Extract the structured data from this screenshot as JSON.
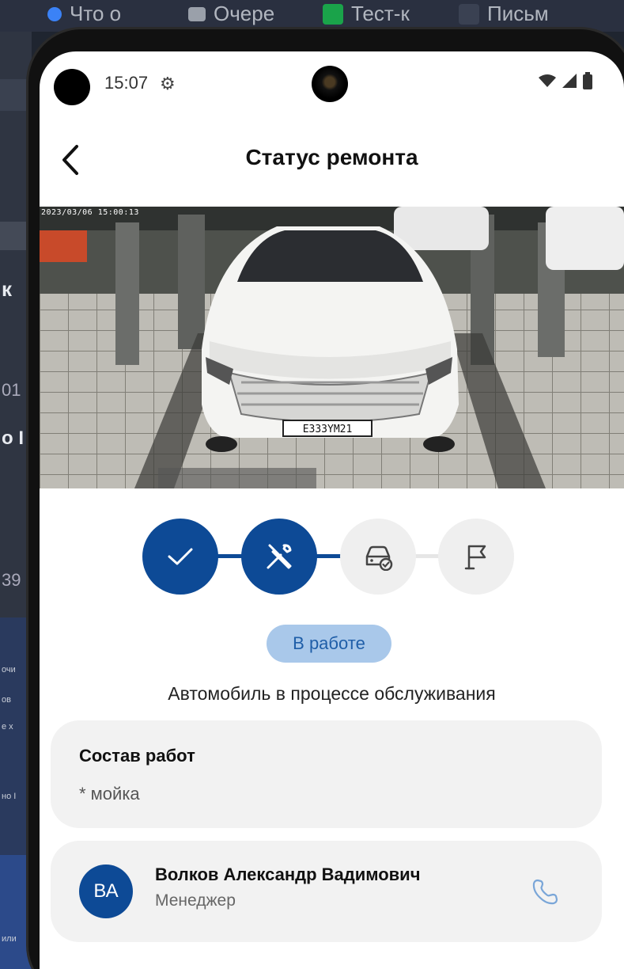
{
  "browser_tabs": [
    {
      "label": "Что о",
      "icon": "app-icon"
    },
    {
      "label": "Очере",
      "icon": "fox-icon"
    },
    {
      "label": "Тест-к",
      "icon": "green-flag-icon"
    },
    {
      "label": "Письм",
      "icon": "mail-icon"
    }
  ],
  "background_fragments": [
    "к",
    "01",
    "о I",
    "39",
    "очи",
    "ов",
    "е х",
    "но I",
    "или"
  ],
  "status_bar": {
    "time": "15:07",
    "icons": [
      "gear-icon",
      "wifi-icon",
      "signal-icon",
      "battery-icon"
    ]
  },
  "header": {
    "title": "Статус ремонта",
    "back_icon": "chevron-left-icon"
  },
  "camera": {
    "timestamp": "2023/03/06 15:00:13",
    "plate": "E333YM21"
  },
  "progress": {
    "steps": [
      {
        "name": "accepted",
        "icon": "check-icon",
        "state": "done"
      },
      {
        "name": "in-repair",
        "icon": "tools-icon",
        "state": "done"
      },
      {
        "name": "car-ready",
        "icon": "car-check-icon",
        "state": "pending"
      },
      {
        "name": "finished",
        "icon": "flag-icon",
        "state": "pending"
      }
    ],
    "status_badge": "В работе",
    "description": "Автомобиль в процессе обслуживания"
  },
  "works": {
    "title": "Состав работ",
    "items": [
      "* мойка"
    ]
  },
  "manager": {
    "initials": "ВА",
    "name": "Волков Александр Вадимович",
    "role": "Менеджер"
  },
  "colors": {
    "primary": "#0d4a96",
    "badge_bg": "#a9c8ea",
    "badge_text": "#1f5ea8",
    "card_bg": "#f2f2f2",
    "pending_step": "#efefef",
    "phone_icon": "#7aa6d8"
  }
}
